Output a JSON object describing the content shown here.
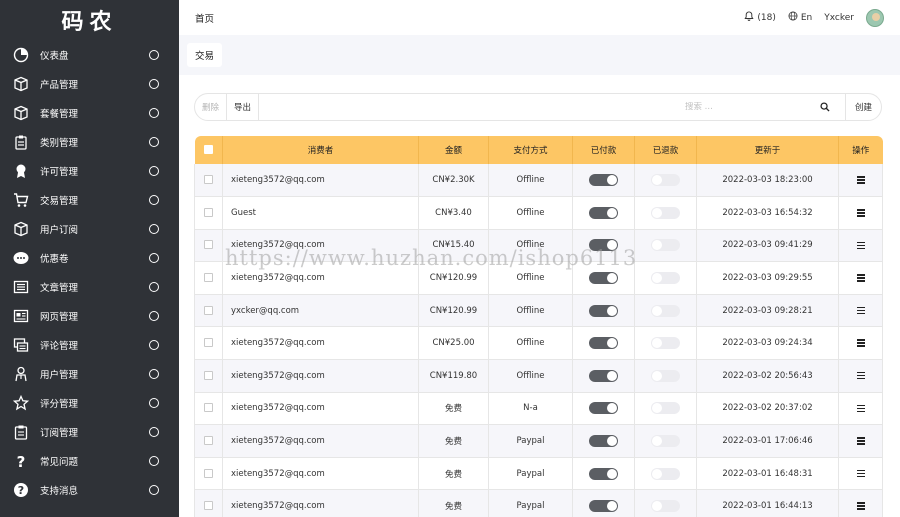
{
  "app": {
    "logo": "码农"
  },
  "sidebar": {
    "items": [
      {
        "label": "仪表盘",
        "icon": "dashboard-icon"
      },
      {
        "label": "产品管理",
        "icon": "box-icon"
      },
      {
        "label": "套餐管理",
        "icon": "package-icon"
      },
      {
        "label": "类别管理",
        "icon": "category-icon"
      },
      {
        "label": "许可管理",
        "icon": "license-icon"
      },
      {
        "label": "交易管理",
        "icon": "cart-icon"
      },
      {
        "label": "用户订阅",
        "icon": "subscription-icon"
      },
      {
        "label": "优惠卷",
        "icon": "coupon-icon"
      },
      {
        "label": "文章管理",
        "icon": "article-icon"
      },
      {
        "label": "网页管理",
        "icon": "webpage-icon"
      },
      {
        "label": "评论管理",
        "icon": "comment-icon"
      },
      {
        "label": "用户管理",
        "icon": "user-icon"
      },
      {
        "label": "评分管理",
        "icon": "star-icon"
      },
      {
        "label": "订阅管理",
        "icon": "clipboard-icon"
      },
      {
        "label": "常见问题",
        "icon": "question-icon"
      },
      {
        "label": "支持消息",
        "icon": "help-circle-icon"
      }
    ]
  },
  "header": {
    "title": "首页",
    "notifications": "(18)",
    "language": "En",
    "username": "Yxcker"
  },
  "breadcrumb": {
    "current": "交易"
  },
  "toolbar": {
    "delete_label": "删除",
    "export_label": "导出",
    "search_placeholder": "搜索 ...",
    "create_label": "创建"
  },
  "table": {
    "columns": [
      "消费者",
      "金额",
      "支付方式",
      "已付款",
      "已退款",
      "更新于",
      "操作"
    ],
    "rows": [
      {
        "consumer": "xieteng3572@qq.com",
        "amount": "CN¥2.30K",
        "payment": "Offline",
        "paid": true,
        "refunded": false,
        "updated": "2022-03-03 18:23:00"
      },
      {
        "consumer": "Guest",
        "amount": "CN¥3.40",
        "payment": "Offline",
        "paid": true,
        "refunded": false,
        "updated": "2022-03-03 16:54:32"
      },
      {
        "consumer": "xieteng3572@qq.com",
        "amount": "CN¥15.40",
        "payment": "Offline",
        "paid": true,
        "refunded": false,
        "updated": "2022-03-03 09:41:29"
      },
      {
        "consumer": "xieteng3572@qq.com",
        "amount": "CN¥120.99",
        "payment": "Offline",
        "paid": true,
        "refunded": false,
        "updated": "2022-03-03 09:29:55"
      },
      {
        "consumer": "yxcker@qq.com",
        "amount": "CN¥120.99",
        "payment": "Offline",
        "paid": true,
        "refunded": false,
        "updated": "2022-03-03 09:28:21"
      },
      {
        "consumer": "xieteng3572@qq.com",
        "amount": "CN¥25.00",
        "payment": "Offline",
        "paid": true,
        "refunded": false,
        "updated": "2022-03-03 09:24:34"
      },
      {
        "consumer": "xieteng3572@qq.com",
        "amount": "CN¥119.80",
        "payment": "Offline",
        "paid": true,
        "refunded": false,
        "updated": "2022-03-02 20:56:43"
      },
      {
        "consumer": "xieteng3572@qq.com",
        "amount": "免费",
        "payment": "N-a",
        "paid": true,
        "refunded": false,
        "updated": "2022-03-02 20:37:02"
      },
      {
        "consumer": "xieteng3572@qq.com",
        "amount": "免费",
        "payment": "Paypal",
        "paid": true,
        "refunded": false,
        "updated": "2022-03-01 17:06:46"
      },
      {
        "consumer": "xieteng3572@qq.com",
        "amount": "免费",
        "payment": "Paypal",
        "paid": true,
        "refunded": false,
        "updated": "2022-03-01 16:48:31"
      },
      {
        "consumer": "xieteng3572@qq.com",
        "amount": "免费",
        "payment": "Paypal",
        "paid": true,
        "refunded": false,
        "updated": "2022-03-01 16:44:13"
      }
    ]
  },
  "watermark": "https://www.huzhan.com/ishop6113"
}
